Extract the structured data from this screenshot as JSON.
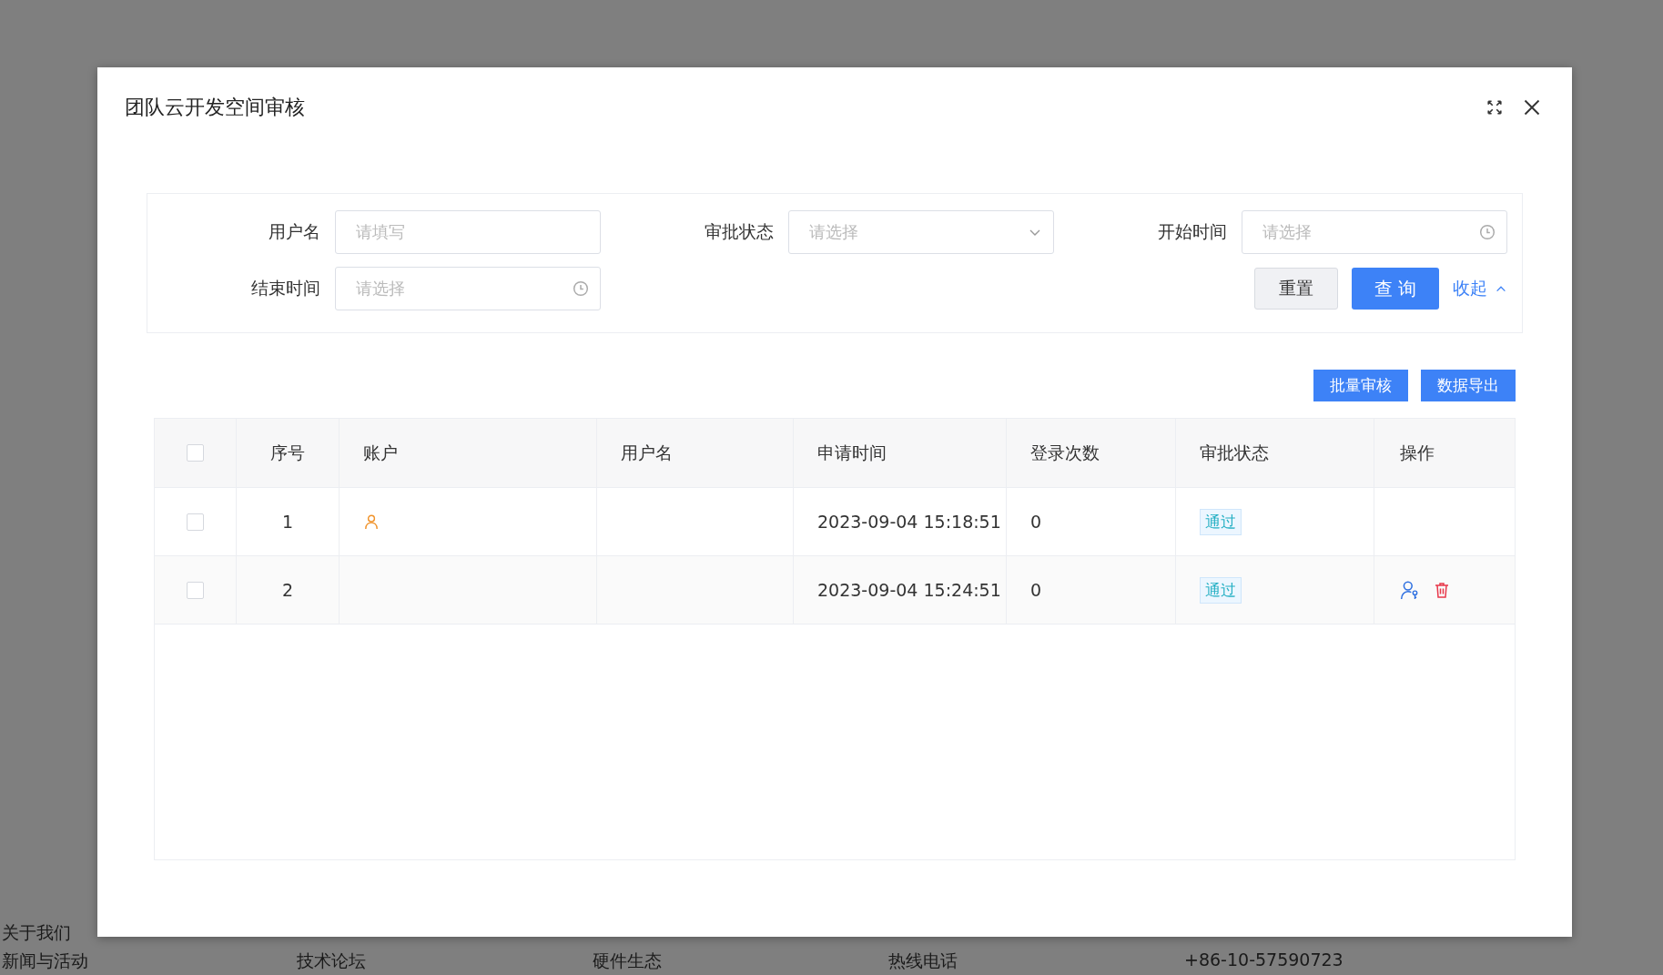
{
  "background": {
    "footer_top": [
      "关于我们"
    ],
    "footer_bottom": [
      "新闻与活动",
      "技术论坛",
      "硬件生态",
      "热线电话",
      "+86-10-57590723"
    ]
  },
  "dialog": {
    "title": "团队云开发空间审核"
  },
  "filters": [
    {
      "label": "用户名",
      "kind": "text",
      "placeholder": "请填写"
    },
    {
      "label": "审批状态",
      "kind": "select",
      "placeholder": "请选择"
    },
    {
      "label": "开始时间",
      "kind": "time",
      "placeholder": "请选择"
    },
    {
      "label": "结束时间",
      "kind": "time",
      "placeholder": "请选择"
    }
  ],
  "filter_buttons": {
    "reset": "重置",
    "query": "查 询",
    "collapse": "收起"
  },
  "toolbar": [
    "批量审核",
    "数据导出"
  ],
  "table": {
    "columns": [
      "序号",
      "账户",
      "用户名",
      "申请时间",
      "登录次数",
      "审批状态",
      "操作"
    ],
    "header_checked": false,
    "rows": [
      {
        "checked": false,
        "index": "1",
        "account_icon": true,
        "time": "2023-09-04 15:18:51",
        "logins": "0",
        "status": "通过",
        "actions": []
      },
      {
        "checked": false,
        "index": "2",
        "account_icon": false,
        "time": "2023-09-04 15:24:51",
        "logins": "0",
        "status": "通过",
        "actions": [
          {
            "kind": "assign"
          },
          {
            "kind": "delete"
          }
        ]
      }
    ]
  }
}
